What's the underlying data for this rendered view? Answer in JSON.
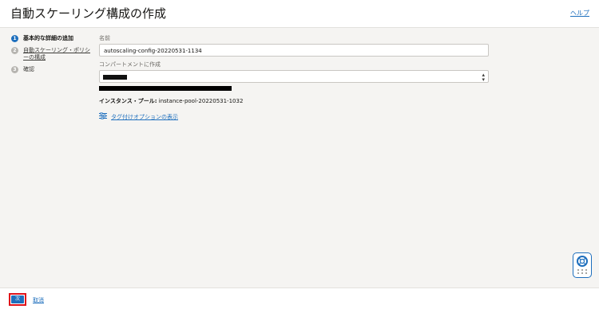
{
  "header": {
    "title": "自動スケーリング構成の作成",
    "help_label": "ヘルプ"
  },
  "steps": [
    {
      "number": "1",
      "label": "基本的な詳細の追加",
      "state": "active"
    },
    {
      "number": "2",
      "label": "自動スケーリング・ポリシーの構成",
      "state": "link"
    },
    {
      "number": "3",
      "label": "確認",
      "state": "pending"
    }
  ],
  "form": {
    "name_label": "名前",
    "name_value": "autoscaling-config-20220531-1134",
    "compartment_label": "コンパートメントに作成",
    "instance_pool_label": "インスタンス・プール:",
    "instance_pool_value": "instance-pool-20220531-1032",
    "tagging_link": "タグ付けオプションの表示"
  },
  "footer": {
    "next_label": "次",
    "cancel_label": "取消"
  },
  "icons": {
    "tagging": "sliders-icon",
    "floating_help": "lifebuoy-icon"
  },
  "colors": {
    "accent": "#1e6fbd",
    "highlight": "#e0131a"
  }
}
